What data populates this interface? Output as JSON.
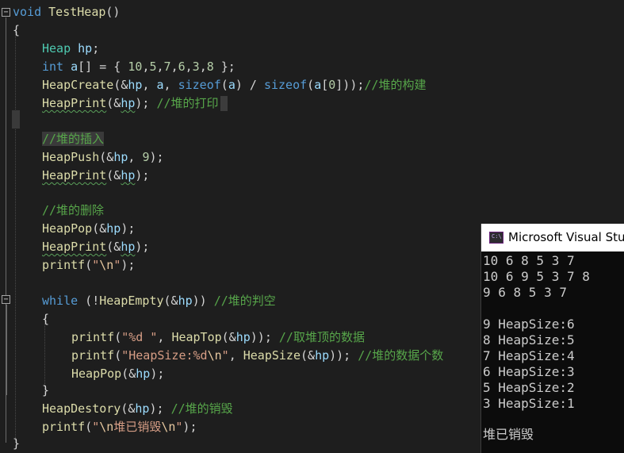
{
  "editor": {
    "fold_collapse_symbol": "−",
    "caret_marker": " ",
    "lines": {
      "l1": {
        "kw": "void",
        "name": " TestHeap",
        "rest": "()"
      },
      "l2": {
        "text": "{"
      },
      "l3": {
        "type": "Heap",
        "sp": " ",
        "var": "hp",
        "semi": ";"
      },
      "l4": {
        "kw": "int",
        "sp": " ",
        "var": "a",
        "mid": "[] = { ",
        "n1": "10",
        "c1": ",",
        "n2": "5",
        "c2": ",",
        "n3": "7",
        "c3": ",",
        "n4": "6",
        "c4": ",",
        "n5": "3",
        "c5": ",",
        "n6": "8",
        "end": " };"
      },
      "l5": {
        "fn": "HeapCreate",
        "p1": "(&",
        "v1": "hp",
        "p2": ", ",
        "v2": "a",
        "p3": ", ",
        "kw1": "sizeof",
        "p4": "(",
        "v3": "a",
        "p5": ") / ",
        "kw2": "sizeof",
        "p6": "(",
        "v4": "a",
        "p7": "[",
        "n": "0",
        "p8": "]));",
        "cm": "//堆的构建"
      },
      "l6": {
        "fn": "HeapPrint",
        "p1": "(&",
        "v": "hp",
        "p2": "); ",
        "cm": "//堆的打印"
      },
      "l8": {
        "cm": "//堆的插入"
      },
      "l9": {
        "fn": "HeapPush",
        "p1": "(&",
        "v": "hp",
        "p2": ", ",
        "n": "9",
        "p3": ");"
      },
      "l10": {
        "fn": "HeapPrint",
        "p1": "(&",
        "v": "hp",
        "p2": ");"
      },
      "l12": {
        "cm": "//堆的删除"
      },
      "l13": {
        "fn": "HeapPop",
        "p1": "(&",
        "v": "hp",
        "p2": ");"
      },
      "l14": {
        "fn": "HeapPrint",
        "p1": "(&",
        "v": "hp",
        "p2": ");"
      },
      "l15": {
        "fn": "printf",
        "p1": "(",
        "s1": "\"",
        "es": "\\n",
        "s2": "\"",
        "p2": ");"
      },
      "l17": {
        "kw": "while",
        "p1": " (!",
        "fn": "HeapEmpty",
        "p2": "(&",
        "v": "hp",
        "p3": ")) ",
        "cm": "//堆的判空"
      },
      "l18": {
        "text": "{"
      },
      "l19": {
        "fn": "printf",
        "p1": "(",
        "s": "\"%d \"",
        "p2": ", ",
        "fn2": "HeapTop",
        "p3": "(&",
        "v": "hp",
        "p4": ")); ",
        "cm": "//取堆顶的数据"
      },
      "l20": {
        "fn": "printf",
        "p1": "(",
        "s1": "\"HeapSize:%d",
        "es": "\\n",
        "s2": "\"",
        "p2": ", ",
        "fn2": "HeapSize",
        "p3": "(&",
        "v": "hp",
        "p4": ")); ",
        "cm": "//堆的数据个数"
      },
      "l21": {
        "fn": "HeapPop",
        "p1": "(&",
        "v": "hp",
        "p2": ");"
      },
      "l22": {
        "text": "}"
      },
      "l23": {
        "fn": "HeapDestory",
        "p1": "(&",
        "v": "hp",
        "p2": "); ",
        "cm": "//堆的销毁"
      },
      "l24": {
        "fn": "printf",
        "p1": "(",
        "s1": "\"",
        "es1": "\\n",
        "s2": "堆已销毁",
        "es2": "\\n",
        "s3": "\"",
        "p2": ");"
      },
      "l25": {
        "text": "}"
      }
    }
  },
  "console": {
    "title": "Microsoft Visual Studio Debug Console",
    "icon_label": "C:\\",
    "output": [
      "10 6 8 5 3 7",
      "10 6 9 5 3 7 8",
      "9 6 8 5 3 7",
      "",
      "9 HeapSize:6",
      "8 HeapSize:5",
      "7 HeapSize:4",
      "6 HeapSize:3",
      "5 HeapSize:2",
      "3 HeapSize:1",
      "",
      "堆已销毁"
    ]
  },
  "colors": {
    "editor_bg": "#1e1e1e",
    "keyword": "#569cd6",
    "type": "#4ec9b0",
    "function": "#dcdcaa",
    "variable": "#9cdcfe",
    "number": "#b5cea8",
    "string": "#d69d85",
    "comment": "#57a64a",
    "console_bg": "#0c0c0c",
    "console_text": "#cccccc"
  }
}
